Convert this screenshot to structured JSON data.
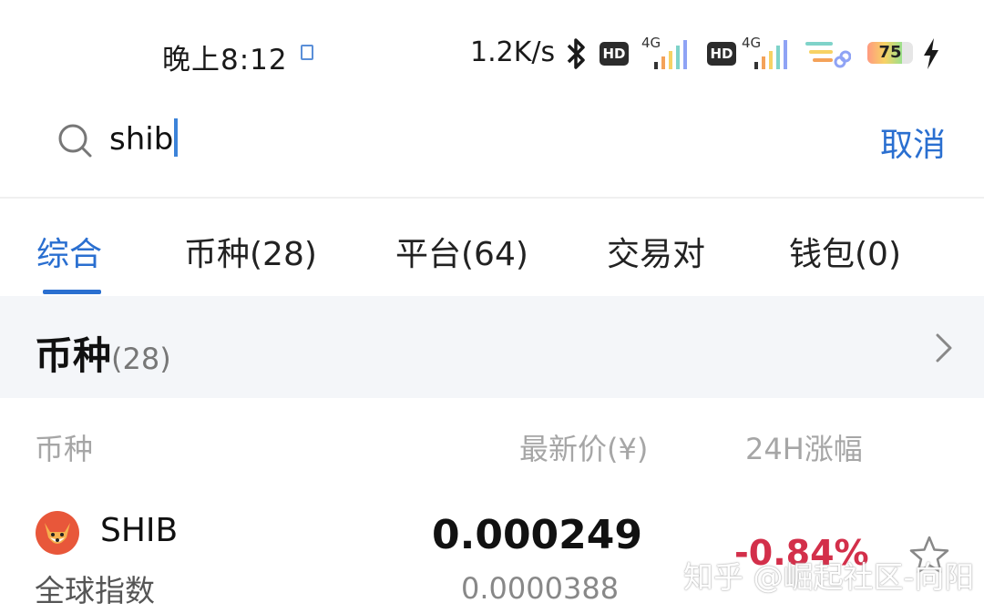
{
  "status_bar": {
    "time": "晚上8:12",
    "network_speed": "1.2K/s",
    "hd_badge_1": "HD",
    "net_type_1": "4G",
    "hd_badge_2": "HD",
    "net_type_2": "4G",
    "battery_percent": "75",
    "battery_level": 0.75
  },
  "search": {
    "query": "shib",
    "cancel_label": "取消"
  },
  "tabs": [
    {
      "label": "综合",
      "active": true
    },
    {
      "label": "币种(28)"
    },
    {
      "label": "平台(64)"
    },
    {
      "label": "交易对"
    },
    {
      "label": "钱包(0)"
    }
  ],
  "section": {
    "title": "币种",
    "count": "(28)"
  },
  "columns": {
    "coin": "币种",
    "latest_price": "最新价(¥)",
    "change_24h": "24H涨幅"
  },
  "results": [
    {
      "symbol": "SHIB",
      "subtitle": "全球指数",
      "price_cny": "0.000249",
      "price_usd": "0.0000388",
      "change_24h": "-0.84%"
    }
  ],
  "watermark": "知乎 @崛起社区-向阳",
  "colors": {
    "accent": "#2a6fd0",
    "negative": "#d32f4a"
  }
}
